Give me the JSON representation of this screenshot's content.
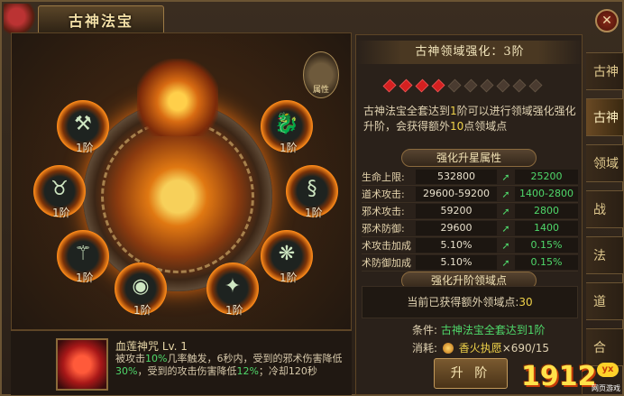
{
  "window": {
    "title": "古神法宝"
  },
  "emblem": {
    "label": "属性"
  },
  "slots": [
    {
      "level": "1阶",
      "icon": "axe-icon"
    },
    {
      "level": "1阶",
      "icon": "jade-dragon-icon"
    },
    {
      "level": "1阶",
      "icon": "horned-beast-icon"
    },
    {
      "level": "1阶",
      "icon": "silver-dragon-icon"
    },
    {
      "level": "1阶",
      "icon": "fire-staff-icon"
    },
    {
      "level": "1阶",
      "icon": "phoenix-icon"
    },
    {
      "level": "1阶",
      "icon": "orb-icon"
    },
    {
      "level": "1阶",
      "icon": "claw-icon"
    }
  ],
  "skill": {
    "name": "血莲神咒  Lv. 1",
    "desc_parts": [
      "被攻击",
      "10%",
      "几率触发，6秒内，受到的邪术伤害降低",
      "30%",
      "，受到的攻击伤害降低",
      "12%",
      "；冷却120秒"
    ]
  },
  "realm": {
    "title": "古神领域强化：3阶",
    "stars_total": 10,
    "stars_on": 4,
    "desc_parts": [
      "古神法宝全套达到",
      "1",
      "阶可以进行领域强化强化升阶，会获得额外",
      "10",
      "点领域点"
    ]
  },
  "star_section": {
    "label": "强化升星属性"
  },
  "attributes": [
    {
      "name": "生命上限:",
      "value": "532800",
      "next": "25200"
    },
    {
      "name": "道术攻击:",
      "value": "29600-59200",
      "next": "1400-2800"
    },
    {
      "name": "邪术攻击:",
      "value": "59200",
      "next": "2800"
    },
    {
      "name": "邪术防御:",
      "value": "29600",
      "next": "1400"
    },
    {
      "name": "术攻击加成",
      "value": "5.10%",
      "next": "0.15%"
    },
    {
      "name": "术防御加成",
      "value": "5.10%",
      "next": "0.15%"
    }
  ],
  "points_section": {
    "label": "强化升阶领域点",
    "text": "当前已获得额外领域点:",
    "value": "30"
  },
  "condition": {
    "label": "条件:",
    "text": "古神法宝全套达到1阶"
  },
  "cost": {
    "label": "消耗:",
    "item": "香火执愿",
    "amount": "×690/15"
  },
  "upgrade_button": "升 阶",
  "side_tabs": [
    "古神",
    "古神",
    "领域",
    "战",
    "法",
    "道",
    "合"
  ],
  "logo": {
    "number": "1912",
    "badge": "yx",
    "caption": "网页游戏"
  },
  "colors": {
    "accent": "#f0d34a",
    "positive": "#4fd86a",
    "frame": "#6b5433"
  }
}
